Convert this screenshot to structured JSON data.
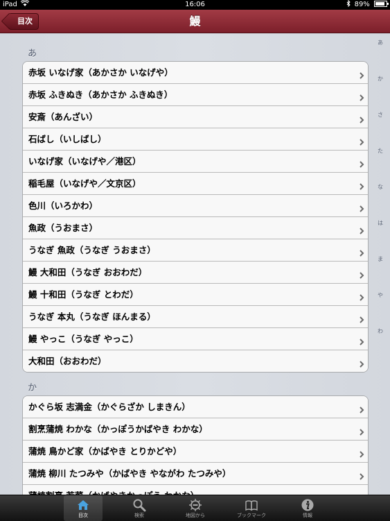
{
  "status_bar": {
    "device": "iPad",
    "time": "16:06",
    "battery": "89%",
    "battery_level": 0.89
  },
  "nav": {
    "back_label": "目次",
    "title": "鰻"
  },
  "sections": [
    {
      "header": "あ",
      "items": [
        "赤坂 いなげ家（あかさか いなげや）",
        "赤坂 ふきぬき（あかさか ふきぬき）",
        "安斎（あんざい）",
        "石ばし（いしばし）",
        "いなげ家（いなげや／港区）",
        "稲毛屋（いなげや／文京区）",
        "色川（いろかわ）",
        "魚政（うおまさ）",
        "うなぎ 魚政（うなぎ うおまさ）",
        "鰻 大和田（うなぎ おおわだ）",
        "鰻 十和田（うなぎ とわだ）",
        "うなぎ 本丸（うなぎ ほんまる）",
        "鰻 やっこ（うなぎ やっこ）",
        "大和田（おおわだ）"
      ]
    },
    {
      "header": "か",
      "items": [
        "かぐら坂 志満金（かぐらざか しまきん）",
        "割烹蒲焼 わかな（かっぽうかばやき わかな）",
        "蒲焼 鳥かど家（かばやき とりかどや）",
        "蒲焼 柳川 たつみや（かばやき やながわ たつみや）",
        "蒲焼割烹 若菜（かばやきかっぽう わかな）"
      ]
    }
  ],
  "index": [
    "あ",
    "か",
    "さ",
    "た",
    "な",
    "は",
    "ま",
    "や",
    "わ"
  ],
  "tabs": [
    {
      "label": "目次",
      "icon": "home-icon",
      "selected": true
    },
    {
      "label": "検索",
      "icon": "search-icon",
      "selected": false
    },
    {
      "label": "地図から",
      "icon": "map-icon",
      "selected": false
    },
    {
      "label": "ブックマーク",
      "icon": "book-icon",
      "selected": false
    },
    {
      "label": "情報",
      "icon": "info-icon",
      "selected": false
    }
  ],
  "colors": {
    "nav_bar": "#8a2a35",
    "tab_selected": "#4aa3e0"
  }
}
